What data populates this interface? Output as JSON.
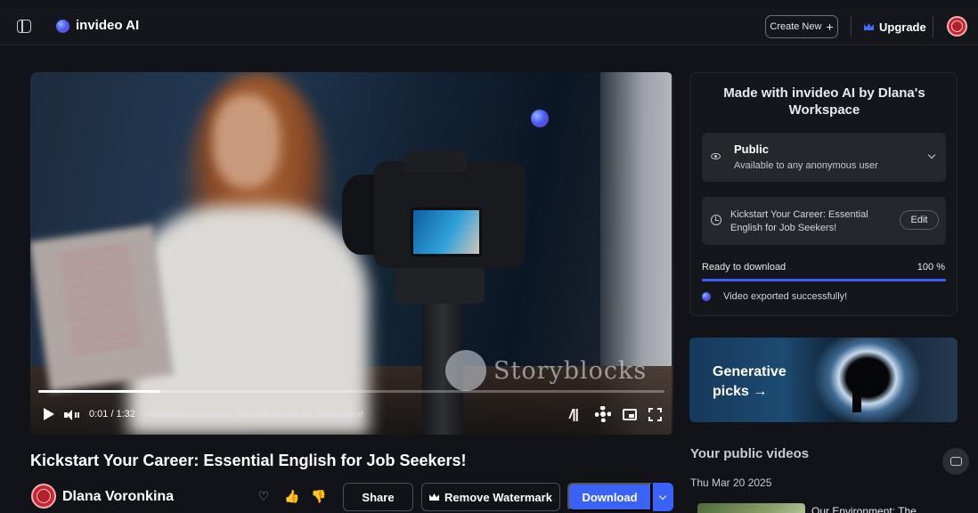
{
  "app": {
    "brand_name": "invideo AI"
  },
  "header": {
    "create_new_label": "Create New",
    "create_new_icon": "+",
    "upgrade_label": "Upgrade"
  },
  "player": {
    "current_time": "0:01",
    "duration": "1:32",
    "time_separator": "/",
    "chapter_title": "• Kickstart Your Career: Essential English for Job Seekers!",
    "progress_fraction": 0.195,
    "watermark_text": "Storyblocks",
    "speed_icon_label": "/||"
  },
  "video": {
    "title": "Kickstart Your Career: Essential English for Job Seekers!",
    "owner_name": "Dlana Voronkina",
    "reaction_icons": {
      "love": "♡",
      "like": "👍",
      "dislike": "👎"
    },
    "share_label": "Share",
    "remove_watermark_label": "Remove Watermark",
    "download_label": "Download"
  },
  "side_panel": {
    "made_with": "Made with invideo AI by Dlana's Workspace",
    "visibility": {
      "title": "Public",
      "subtitle": "Available to any anonymous user"
    },
    "video_name": "Kickstart Your Career: Essential English for Job Seekers!",
    "edit_label": "Edit",
    "ready_label": "Ready to download",
    "ready_percent_text": "100 %",
    "ready_fraction": 1.0,
    "export_message": "Video exported successfully!"
  },
  "promo": {
    "text": "Generative picks →"
  },
  "public_videos": {
    "title": "Your public videos",
    "date": "Thu Mar 20 2025",
    "items": [
      {
        "title": "Our Environment: The"
      }
    ]
  },
  "colors": {
    "accent": "#3b62f6",
    "background": "#121318",
    "panel": "#25272d"
  }
}
